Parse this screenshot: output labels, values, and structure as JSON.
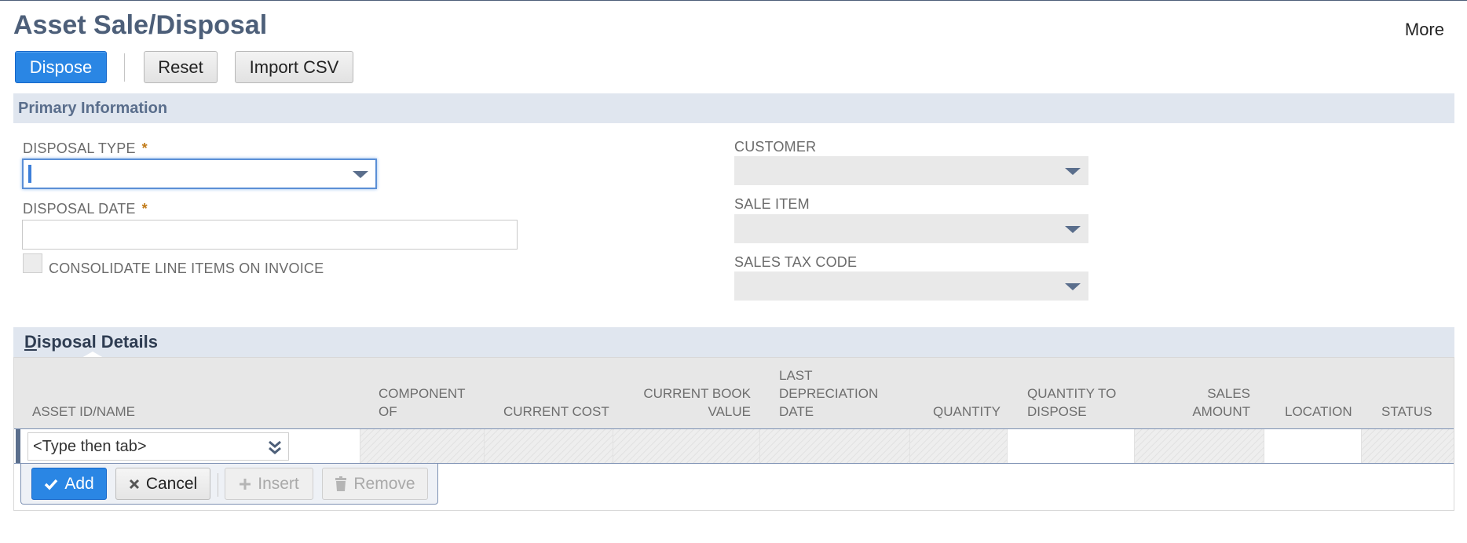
{
  "page": {
    "title": "Asset Sale/Disposal",
    "more_label": "More"
  },
  "toolbar": {
    "dispose_label": "Dispose",
    "reset_label": "Reset",
    "import_label": "Import CSV"
  },
  "primary": {
    "section_title": "Primary Information",
    "disposal_type": {
      "label": "DISPOSAL TYPE",
      "required": "*",
      "value": ""
    },
    "disposal_date": {
      "label": "DISPOSAL DATE",
      "required": "*",
      "value": ""
    },
    "consolidate": {
      "label": "CONSOLIDATE LINE ITEMS ON INVOICE",
      "checked": false
    },
    "customer": {
      "label": "CUSTOMER",
      "value": ""
    },
    "sale_item": {
      "label": "SALE ITEM",
      "value": ""
    },
    "sales_tax_code": {
      "label": "SALES TAX CODE",
      "value": ""
    }
  },
  "details": {
    "tab_label_first": "D",
    "tab_label_rest": "isposal Details",
    "columns": {
      "asset": "ASSET ID/NAME",
      "component_1": "COMPONENT",
      "component_2": "OF",
      "current_cost": "CURRENT COST",
      "book_value_1": "CURRENT BOOK",
      "book_value_2": "VALUE",
      "last_dep_1": "LAST",
      "last_dep_2": "DEPRECIATION",
      "last_dep_3": "DATE",
      "quantity": "QUANTITY",
      "qty_dispose_1": "QUANTITY TO",
      "qty_dispose_2": "DISPOSE",
      "sales_amount_1": "SALES",
      "sales_amount_2": "AMOUNT",
      "location": "LOCATION",
      "status": "STATUS"
    },
    "row": {
      "asset_placeholder": "<Type then tab>"
    },
    "actions": {
      "add": "Add",
      "cancel": "Cancel",
      "insert": "Insert",
      "remove": "Remove"
    }
  },
  "colors": {
    "title": "#4d5f79",
    "primary_button": "#2a86e4",
    "section_bg": "#e0e6ef",
    "required": "#c17b1a"
  }
}
